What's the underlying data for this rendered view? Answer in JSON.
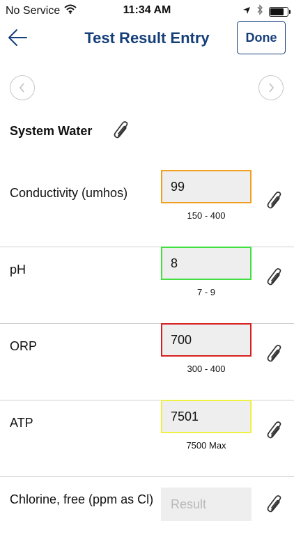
{
  "status_bar": {
    "carrier": "No Service",
    "time": "11:34 AM",
    "battery_level": 0.85
  },
  "nav": {
    "title": "Test Result Entry",
    "done_label": "Done"
  },
  "section": {
    "title": "System Water"
  },
  "rows": [
    {
      "label": "Conductivity (umhos)",
      "value": "99",
      "range": "150 - 400",
      "border_color": "#f0a020"
    },
    {
      "label": "pH",
      "value": "8",
      "range": "7 - 9",
      "border_color": "#3fe03f"
    },
    {
      "label": "ORP",
      "value": "700",
      "range": "300 - 400",
      "border_color": "#d62020"
    },
    {
      "label": "ATP",
      "value": "7501",
      "range": "7500 Max",
      "border_color": "#f0f040"
    },
    {
      "label": "Chlorine, free (ppm as Cl)",
      "value": "",
      "placeholder": "Result",
      "range": "",
      "border_color": "#eeeeef"
    }
  ],
  "icons": {
    "back": "arrow-left-icon",
    "prev": "chevron-left-icon",
    "next": "chevron-right-icon",
    "attach": "paperclip-icon",
    "wifi": "wifi-icon",
    "location": "location-arrow-icon",
    "bluetooth": "bluetooth-icon",
    "battery": "battery-icon"
  }
}
